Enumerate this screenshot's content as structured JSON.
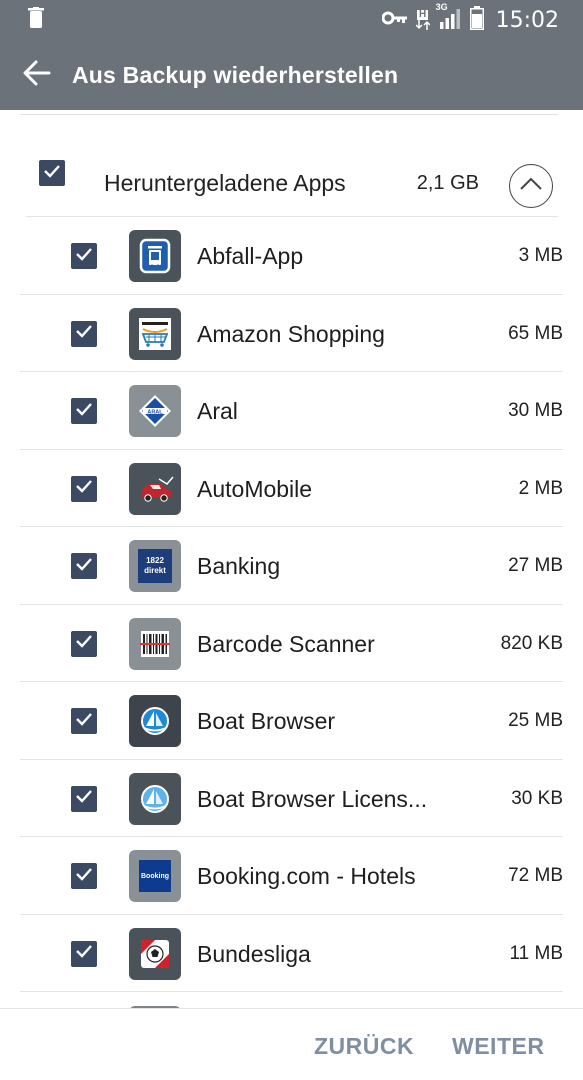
{
  "status_bar": {
    "time": "15:02",
    "network": "3G",
    "icons": [
      "trash-icon",
      "key-icon",
      "hplus-icon",
      "signal-icon",
      "battery-icon"
    ]
  },
  "app_bar": {
    "title": "Aus Backup wiederherstellen",
    "back_icon": "arrow-left-icon"
  },
  "group": {
    "label": "Heruntergeladene Apps",
    "size": "2,1 GB",
    "checked": true,
    "expanded": true
  },
  "apps": [
    {
      "name": "Abfall-App",
      "size": "3 MB",
      "checked": true,
      "icon": "abfall-app-icon"
    },
    {
      "name": "Amazon Shopping",
      "size": "65 MB",
      "checked": true,
      "icon": "amazon-icon"
    },
    {
      "name": "Aral",
      "size": "30 MB",
      "checked": true,
      "icon": "aral-icon"
    },
    {
      "name": "AutoMobile",
      "size": "2 MB",
      "checked": true,
      "icon": "automobile-icon"
    },
    {
      "name": "Banking",
      "size": "27 MB",
      "checked": true,
      "icon": "banking-icon",
      "icon_text": "1822 direkt"
    },
    {
      "name": "Barcode Scanner",
      "size": "820 KB",
      "checked": true,
      "icon": "barcode-icon"
    },
    {
      "name": "Boat Browser",
      "size": "25 MB",
      "checked": true,
      "icon": "boat-browser-icon"
    },
    {
      "name": "Boat Browser Licens...",
      "size": "30 KB",
      "checked": true,
      "icon": "boat-browser-license-icon"
    },
    {
      "name": "Booking.com - Hotels",
      "size": "72 MB",
      "checked": true,
      "icon": "booking-icon",
      "icon_text": "Booking"
    },
    {
      "name": "Bundesliga",
      "size": "11 MB",
      "checked": true,
      "icon": "bundesliga-icon"
    }
  ],
  "footer": {
    "back_label": "ZURÜCK",
    "next_label": "WEITER"
  },
  "colors": {
    "header": "#6b7279",
    "checkbox": "#3b4a62",
    "footer_button": "#7f8ea0"
  }
}
